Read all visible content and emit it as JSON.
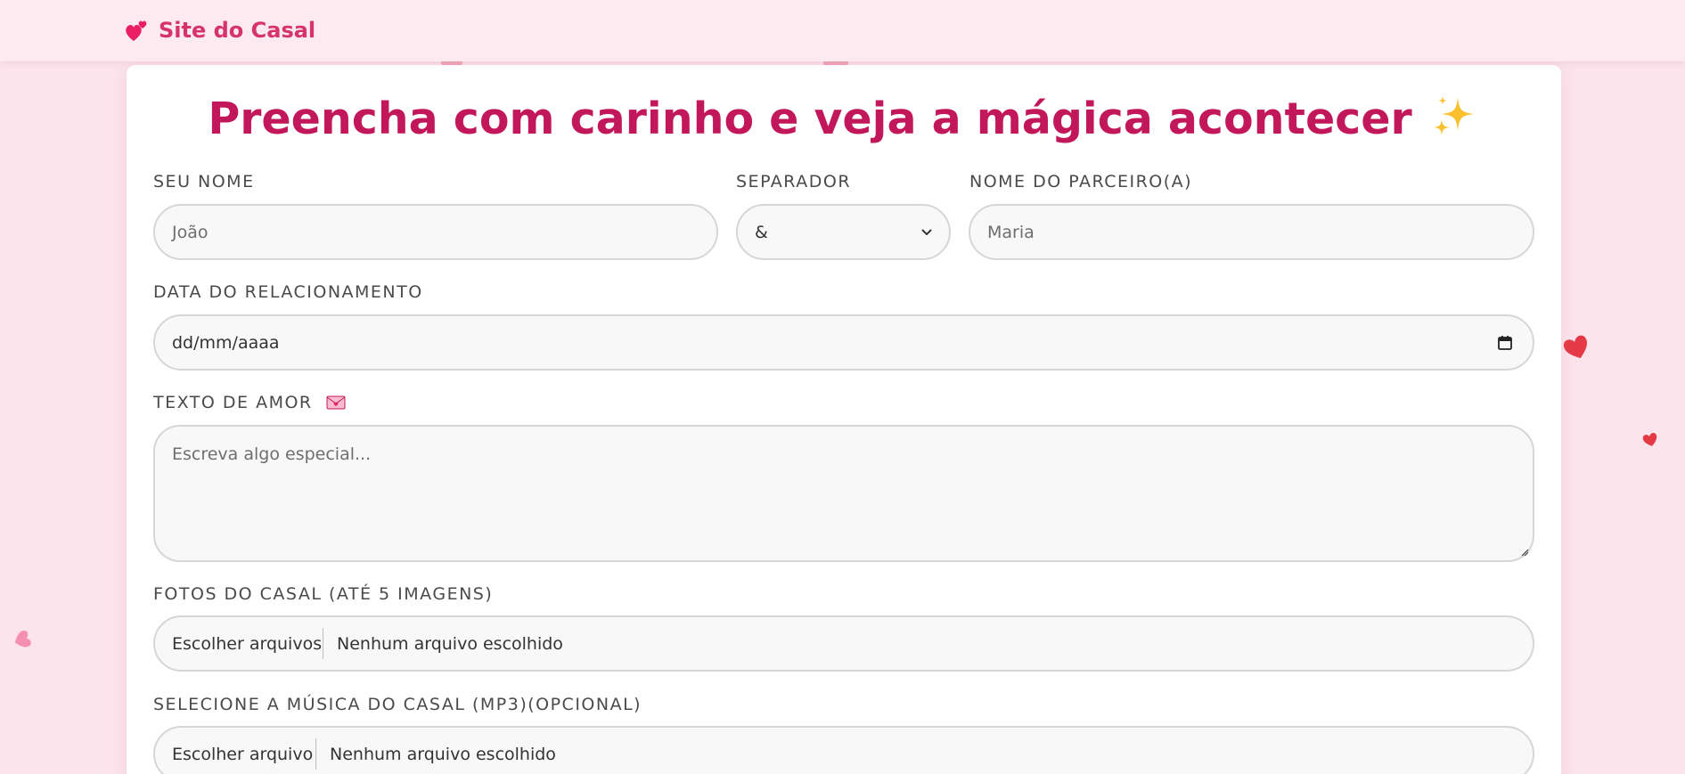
{
  "navbar": {
    "brand_icon": "two-hearts-icon",
    "brand_text": "Site do Casal"
  },
  "form": {
    "title": "Preencha com carinho e veja a mágica acontecer",
    "title_icon": "sparkles-icon",
    "your_name": {
      "label": "SEU NOME",
      "placeholder": "João"
    },
    "separator": {
      "label": "SEPARADOR",
      "value": "&"
    },
    "partner_name": {
      "label": "NOME DO PARCEIRO(A)",
      "placeholder": "Maria"
    },
    "relationship_date": {
      "label": "DATA DO RELACIONAMENTO",
      "placeholder": "dd/mm/aaaa",
      "icon": "calendar-icon"
    },
    "love_text": {
      "label": "TEXTO DE AMOR",
      "label_icon": "love-letter-icon",
      "placeholder": "Escreva algo especial..."
    },
    "photos": {
      "label": "FOTOS DO CASAL (ATÉ 5 IMAGENS)",
      "button": "Escolher arquivos",
      "status": "Nenhum arquivo escolhido"
    },
    "music": {
      "label": "SELECIONE A MÚSICA DO CASAL (MP3)(OPCIONAL)",
      "button": "Escolher arquivo",
      "status": "Nenhum arquivo escolhido"
    }
  },
  "colors": {
    "brand": "#d6336c",
    "title": "#c2185b",
    "background": "#fce4ec",
    "floating_heart_red": "#e53946",
    "floating_heart_pink": "#f48fb1"
  }
}
